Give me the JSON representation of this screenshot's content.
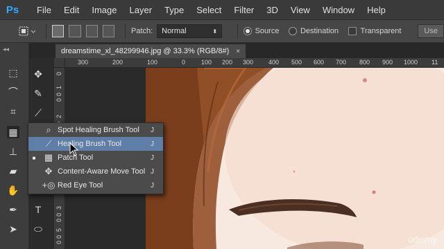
{
  "app": {
    "logo": "Ps"
  },
  "menu": [
    "File",
    "Edit",
    "Image",
    "Layer",
    "Type",
    "Select",
    "Filter",
    "3D",
    "View",
    "Window",
    "Help"
  ],
  "options": {
    "patch_label": "Patch:",
    "patch_value": "Normal",
    "source_label": "Source",
    "destination_label": "Destination",
    "transparent_label": "Transparent",
    "use_label": "Use"
  },
  "document": {
    "tab_title": "dreamstime_xl_48299946.jpg @ 33.3% (RGB/8#)",
    "close_glyph": "×"
  },
  "ruler_top": [
    "300",
    "200",
    "100",
    "0",
    "100",
    "200",
    "300",
    "400",
    "500",
    "600",
    "700",
    "800",
    "900",
    "1000",
    "11"
  ],
  "ruler_left": [
    "0",
    "1",
    "0",
    "0",
    "2",
    "0",
    "0",
    "3",
    "0",
    "0",
    "5",
    "0",
    "0"
  ],
  "flyout": [
    {
      "bullet": "",
      "label": "Spot Healing Brush Tool",
      "key": "J"
    },
    {
      "bullet": "",
      "label": "Healing Brush Tool",
      "key": "J"
    },
    {
      "bullet": "■",
      "label": "Patch Tool",
      "key": "J"
    },
    {
      "bullet": "",
      "label": "Content-Aware Move Tool",
      "key": "J"
    },
    {
      "bullet": "",
      "label": "Red Eye Tool",
      "key": "J"
    }
  ],
  "watermark": "udemy",
  "colors": {
    "highlight": "#5f7ea8",
    "skin": "#f4ddd0",
    "hair": "#7a3e1c",
    "logo": "#31a8ff"
  },
  "icons": {
    "marquee": "marquee-icon",
    "move": "move-icon",
    "lasso": "lasso-icon",
    "quick-select": "quick-select-icon",
    "crop": "crop-icon",
    "eyedropper": "eyedropper-icon",
    "patch": "patch-icon",
    "brush": "brush-icon",
    "stamp": "clone-stamp-icon",
    "history": "history-brush-icon",
    "eraser": "eraser-icon",
    "gradient": "gradient-icon",
    "blur": "blur-icon",
    "dodge": "dodge-icon",
    "pen": "pen-icon",
    "type": "type-icon",
    "path-select": "path-select-icon",
    "shape": "ellipse-icon"
  }
}
